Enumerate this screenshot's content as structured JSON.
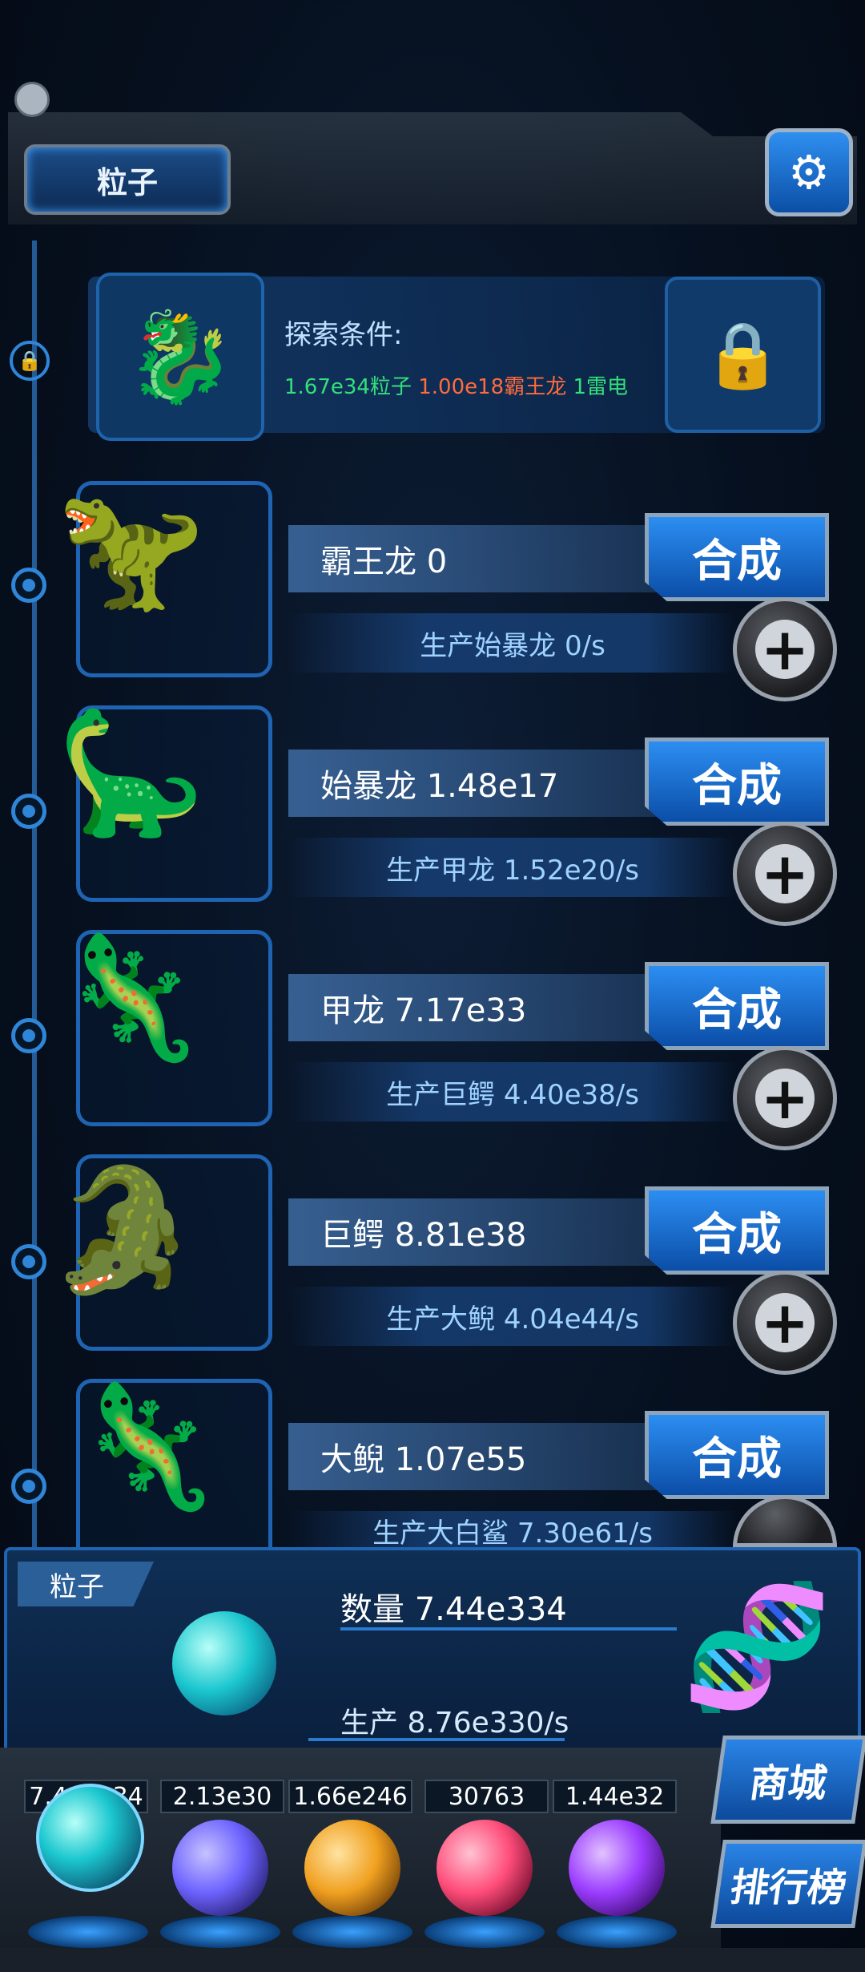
{
  "header": {
    "title": "粒子",
    "settings_icon": "gear-icon"
  },
  "explore": {
    "label": "探索条件:",
    "requirements": [
      {
        "text": "1.67e34粒子",
        "color": "#34e07a"
      },
      {
        "text": "1.00e18霸王龙",
        "color": "#ff6b3d"
      },
      {
        "text": "1雷电",
        "color": "#34e07a"
      }
    ],
    "locked_icon": "lock-icon"
  },
  "creatures": [
    {
      "icon": "t-rex",
      "name": "霸王龙 0",
      "production": "生产始暴龙 0/s",
      "synth_label": "合成"
    },
    {
      "icon": "dinosaur",
      "name": "始暴龙 1.48e17",
      "production": "生产甲龙 1.52e20/s",
      "synth_label": "合成"
    },
    {
      "icon": "ankylosaurus",
      "name": "甲龙 7.17e33",
      "production": "生产巨鳄 4.40e38/s",
      "synth_label": "合成"
    },
    {
      "icon": "crocodile",
      "name": "巨鳄 8.81e38",
      "production": "生产大鲵 4.04e44/s",
      "synth_label": "合成"
    },
    {
      "icon": "salamander",
      "name": "大鲵 1.07e55",
      "production": "生产大白鲨 7.30e61/s",
      "synth_label": "合成"
    }
  ],
  "info": {
    "tag": "粒子",
    "quantity": "数量 7.44e334",
    "rate": "生产 8.76e330/s"
  },
  "resources": [
    {
      "value": "7.44e334",
      "color": "#1bc7cf"
    },
    {
      "value": "2.13e30",
      "color": "#6d63ff"
    },
    {
      "value": "1.66e246",
      "color": "#f0a020"
    },
    {
      "value": "30763",
      "color": "#ff4d7a"
    },
    {
      "value": "1.44e32",
      "color": "#9b3dff"
    }
  ],
  "side_buttons": {
    "shop": "商城",
    "ranking": "排行榜"
  }
}
